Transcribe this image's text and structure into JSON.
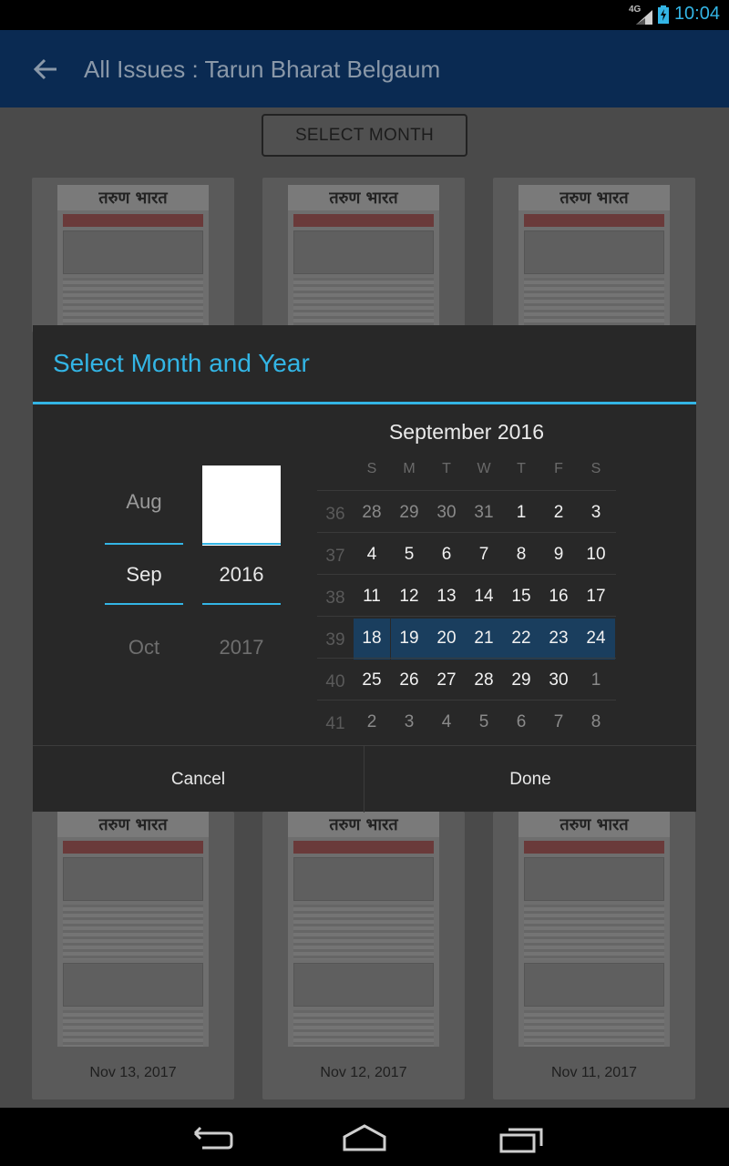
{
  "status_bar": {
    "network": "4G",
    "time": "10:04",
    "icons": [
      "signal-icon",
      "battery-charging-icon"
    ]
  },
  "action_bar": {
    "back_icon": "back-arrow-icon",
    "title": "All Issues : Tarun Bharat Belgaum"
  },
  "content": {
    "select_month_label": "SELECT MONTH",
    "masthead": "तरुण भारत",
    "top_row": [
      {
        "date": ""
      },
      {
        "date": ""
      },
      {
        "date": ""
      }
    ],
    "bottom_row": [
      {
        "date": "Nov 13, 2017"
      },
      {
        "date": "Nov 12, 2017"
      },
      {
        "date": "Nov 11, 2017"
      }
    ]
  },
  "dialog": {
    "title": "Select Month and Year",
    "month_picker": {
      "prev": "Aug",
      "selected": "Sep",
      "next": "Oct"
    },
    "year_picker": {
      "prev": "",
      "selected": "2016",
      "next": "2017"
    },
    "calendar": {
      "month_label": "September 2016",
      "weekdays": [
        "S",
        "M",
        "T",
        "W",
        "T",
        "F",
        "S"
      ],
      "weeks": [
        {
          "num": "36",
          "days": [
            "28",
            "29",
            "30",
            "31",
            "1",
            "2",
            "3"
          ]
        },
        {
          "num": "37",
          "days": [
            "4",
            "5",
            "6",
            "7",
            "8",
            "9",
            "10"
          ]
        },
        {
          "num": "38",
          "days": [
            "11",
            "12",
            "13",
            "14",
            "15",
            "16",
            "17"
          ]
        },
        {
          "num": "39",
          "days": [
            "18",
            "19",
            "20",
            "21",
            "22",
            "23",
            "24"
          ]
        },
        {
          "num": "40",
          "days": [
            "25",
            "26",
            "27",
            "28",
            "29",
            "30",
            "1"
          ]
        },
        {
          "num": "41",
          "days": [
            "2",
            "3",
            "4",
            "5",
            "6",
            "7",
            "8"
          ]
        }
      ],
      "selected_week": "39"
    },
    "cancel_label": "Cancel",
    "done_label": "Done"
  },
  "colors": {
    "accent": "#33b5e5",
    "action_bar": "#0a2a52",
    "week_highlight": "#1a3e5e"
  },
  "nav_bar": {
    "icons": [
      "back-nav-icon",
      "home-nav-icon",
      "recents-nav-icon"
    ]
  }
}
